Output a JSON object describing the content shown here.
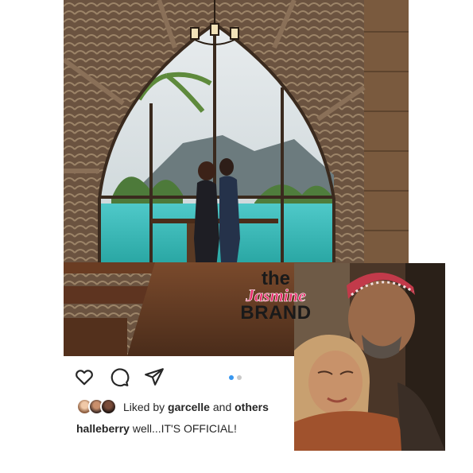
{
  "post": {
    "photo_alt_icon": "photo-carousel-image",
    "actions": [
      "like-icon",
      "comment-icon",
      "share-icon"
    ],
    "carousel": {
      "count": 2,
      "active": 1
    },
    "liked_by": {
      "prefix": "Liked by",
      "user": "garcelle",
      "joiner": "and",
      "others": "others"
    },
    "caption": {
      "username": "halleberry",
      "text": "well...IT'S OFFICIAL!"
    }
  },
  "watermark": {
    "line1": "the",
    "line2": "Jasmine",
    "line3": "BRAND"
  },
  "colors": {
    "accent": "#3897f0",
    "brand_pink": "#e9286a",
    "text": "#262626"
  }
}
